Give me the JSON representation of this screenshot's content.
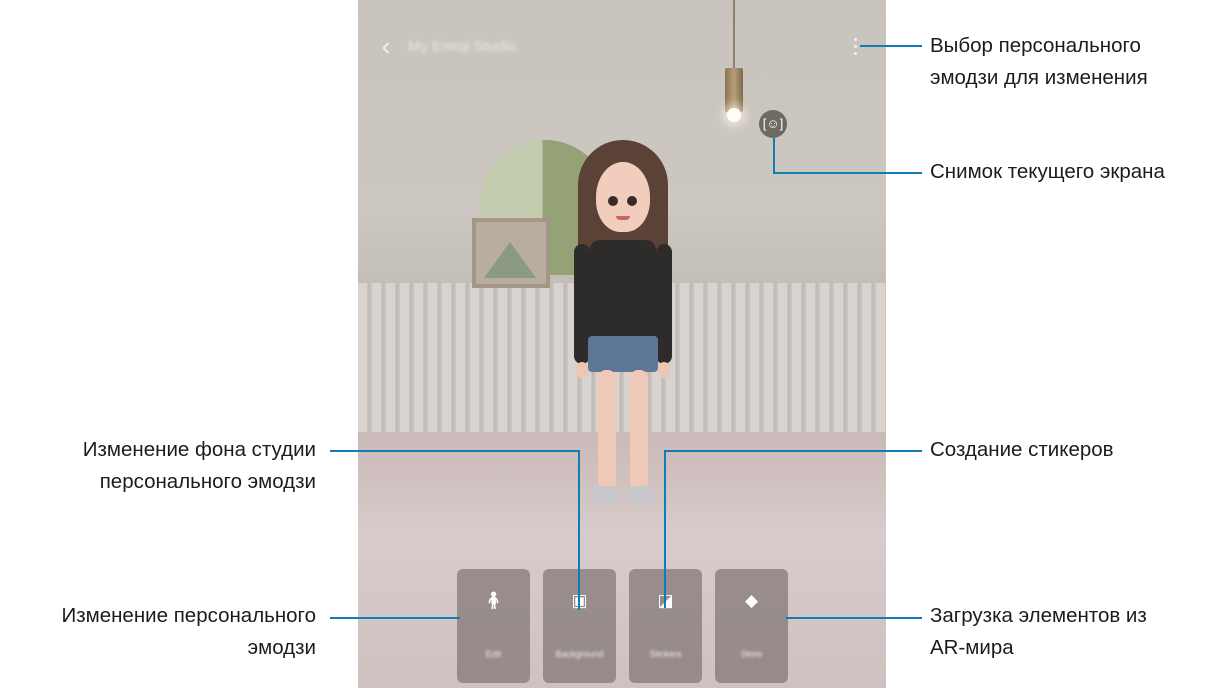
{
  "screen": {
    "title": "My Emoji Studio",
    "capture_icon": "[☺]",
    "tiles": [
      {
        "label": "Edit",
        "icon": "person-icon",
        "glyph": "🯅"
      },
      {
        "label": "Background",
        "icon": "image-icon",
        "glyph": "▣"
      },
      {
        "label": "Stickers",
        "icon": "sticker-icon",
        "glyph": "◪"
      },
      {
        "label": "Store",
        "icon": "bag-icon",
        "glyph": "◆"
      }
    ]
  },
  "callouts": {
    "select_emoji": {
      "line1": "Выбор персонального",
      "line2": "эмодзи для изменения"
    },
    "screenshot": {
      "line1": "Снимок текущего экрана"
    },
    "background": {
      "line1": "Изменение фона студии",
      "line2": "персонального эмодзи"
    },
    "stickers": {
      "line1": "Создание стикеров"
    },
    "edit_emoji": {
      "line1": "Изменение персонального",
      "line2": "эмодзи"
    },
    "download": {
      "line1": "Загрузка элементов из",
      "line2": "AR-мира"
    }
  },
  "colors": {
    "accent_line": "#0e7fb6"
  }
}
